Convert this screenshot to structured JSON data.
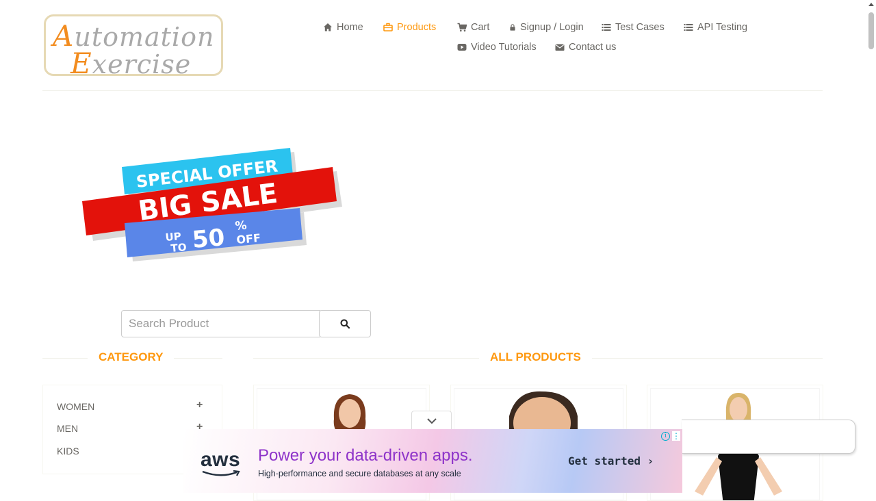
{
  "logo": {
    "line1_cap": "A",
    "line1_rest": "utomation",
    "line2_cap": "E",
    "line2_rest": "xercise"
  },
  "nav": {
    "items": [
      {
        "label": "Home",
        "icon": "home-icon"
      },
      {
        "label": "Products",
        "icon": "briefcase-icon",
        "active": true
      },
      {
        "label": "Cart",
        "icon": "cart-icon"
      },
      {
        "label": "Signup / Login",
        "icon": "lock-icon"
      },
      {
        "label": "Test Cases",
        "icon": "list-icon"
      },
      {
        "label": "API Testing",
        "icon": "list-icon"
      },
      {
        "label": "Video Tutorials",
        "icon": "youtube-play-icon"
      },
      {
        "label": "Contact us",
        "icon": "envelope-icon"
      }
    ]
  },
  "banner": {
    "line1": "SPECIAL OFFER",
    "line2": "BIG SALE",
    "line3_up": "UP",
    "line3_to": "TO",
    "line3_num": "50",
    "line3_pct": "%",
    "line3_off": "OFF"
  },
  "search": {
    "placeholder": "Search Product",
    "value": ""
  },
  "category": {
    "title": "Category",
    "items": [
      {
        "label": "Women"
      },
      {
        "label": "Men"
      },
      {
        "label": "Kids"
      }
    ]
  },
  "products": {
    "title": "All Products",
    "count_visible": 3
  },
  "ad": {
    "brand": "aws",
    "headline": "Power your data-driven apps.",
    "subline": "High-performance and secure databases at any scale",
    "cta": "Get started ›"
  },
  "colors": {
    "accent": "#fe980f",
    "text": "#696763",
    "ad_headline": "#8e33c9"
  }
}
